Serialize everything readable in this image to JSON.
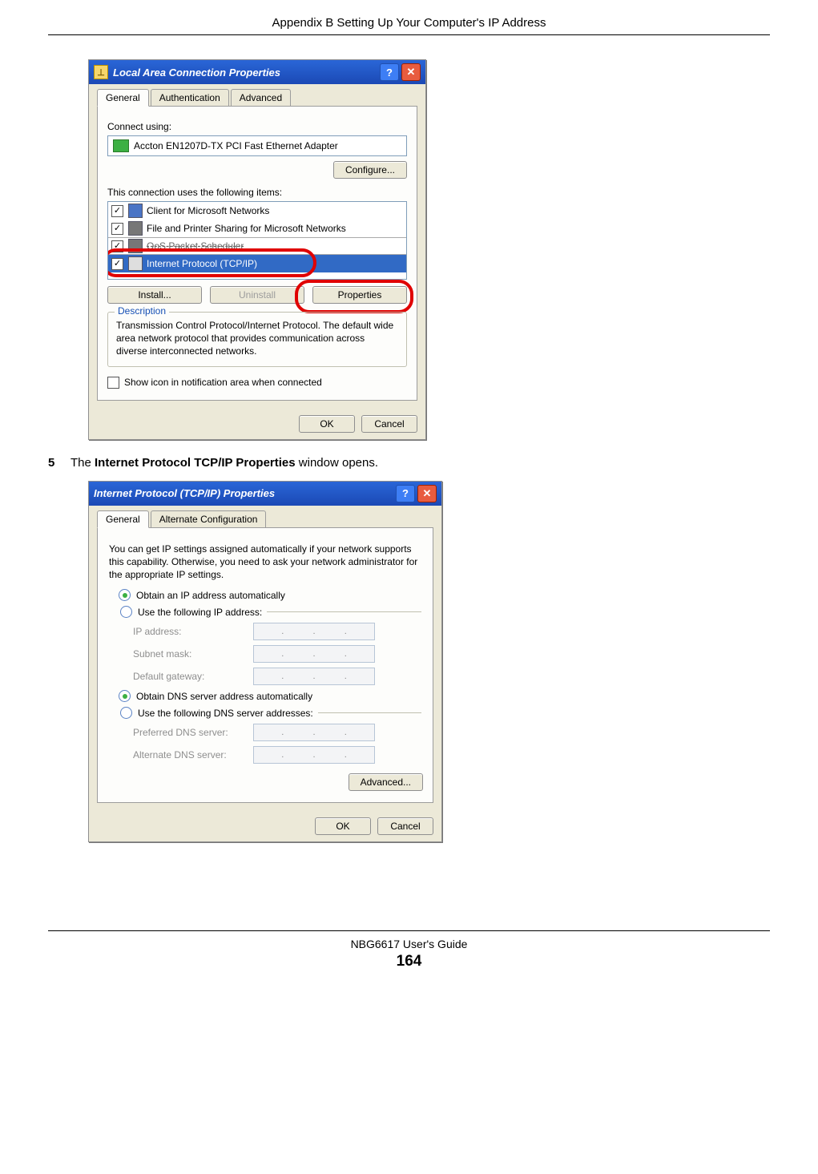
{
  "header": "Appendix B Setting Up Your Computer's IP Address",
  "step": {
    "num": "5",
    "text_pre": "The ",
    "text_bold": "Internet Protocol TCP/IP Properties",
    "text_post": " window opens."
  },
  "win1": {
    "title": "Local Area Connection Properties",
    "tabs": [
      "General",
      "Authentication",
      "Advanced"
    ],
    "connect_using_label": "Connect using:",
    "adapter": "Accton EN1207D-TX PCI Fast Ethernet Adapter",
    "configure_btn": "Configure...",
    "items_label": "This connection uses the following items:",
    "items": [
      {
        "checked": true,
        "label": "Client for Microsoft Networks"
      },
      {
        "checked": true,
        "label": "File and Printer Sharing for Microsoft Networks"
      },
      {
        "checked": true,
        "label": "QoS Packet Scheduler",
        "cut": true
      },
      {
        "checked": true,
        "label": "Internet Protocol (TCP/IP)",
        "selected": true
      }
    ],
    "install_btn": "Install...",
    "uninstall_btn": "Uninstall",
    "properties_btn": "Properties",
    "desc_legend": "Description",
    "desc_text": "Transmission Control Protocol/Internet Protocol. The default wide area network protocol that provides communication across diverse interconnected networks.",
    "show_icon": "Show icon in notification area when connected",
    "ok": "OK",
    "cancel": "Cancel"
  },
  "win2": {
    "title": "Internet Protocol (TCP/IP) Properties",
    "tabs": [
      "General",
      "Alternate Configuration"
    ],
    "intro": "You can get IP settings assigned automatically if your network supports this capability. Otherwise, you need to ask your network administrator for the appropriate IP settings.",
    "r_ip_auto": "Obtain an IP address automatically",
    "r_ip_manual": "Use the following IP address:",
    "ip_label": "IP address:",
    "subnet_label": "Subnet mask:",
    "gateway_label": "Default gateway:",
    "r_dns_auto": "Obtain DNS server address automatically",
    "r_dns_manual": "Use the following DNS server addresses:",
    "pref_dns": "Preferred DNS server:",
    "alt_dns": "Alternate DNS server:",
    "advanced_btn": "Advanced...",
    "ok": "OK",
    "cancel": "Cancel"
  },
  "footer": {
    "guide": "NBG6617 User's Guide",
    "page": "164"
  }
}
